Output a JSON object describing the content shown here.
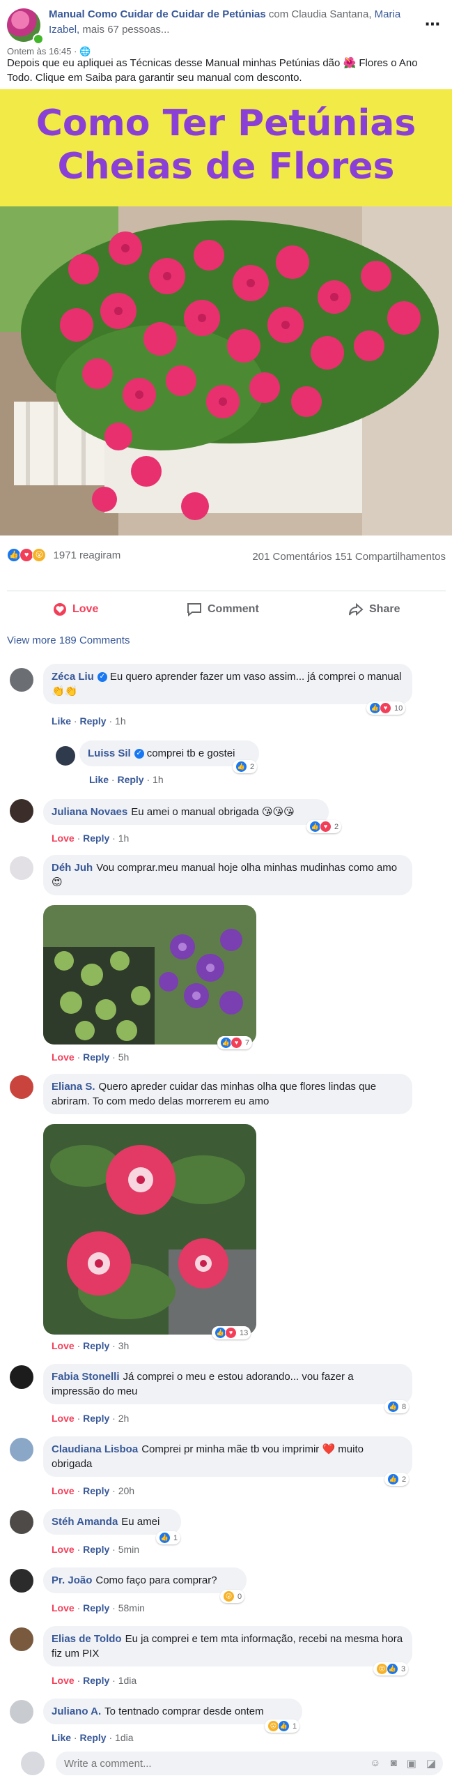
{
  "post": {
    "page_name": "Manual Como Cuidar de Cuidar de Petúnias",
    "with_text": "com Claudia Santana,",
    "with_people": "Maria Izabel,",
    "more_people": "mais 67 pessoas...",
    "time": "Ontem às 16:45 · 🌐",
    "text": "Depois que eu apliquei as Técnicas desse Manual minhas Petúnias dão 🌺 Flores o Ano Todo. Clique em Saiba para garantir seu manual com desconto.",
    "more_icon": "⋯"
  },
  "hero": {
    "line1": "Como Ter Petúnias",
    "line2": "Cheias de Flores"
  },
  "stats": {
    "reactions": "1971 reagiram",
    "comments_shares": "201 Comentários 151 Compartilhamentos"
  },
  "actions": {
    "love": "Love",
    "comment": "Comment",
    "share": "Share"
  },
  "view_more": "View more 189 Comments",
  "comments": [
    {
      "name": "Zéca Liu",
      "text": "Eu quero aprender fazer um vaso assim... já comprei o manual👏👏",
      "like": "Like",
      "reply": "Reply",
      "time": "1h",
      "count": "10"
    },
    {
      "name": "Luiss Sil",
      "text": "comprei tb e gostei",
      "like": "Like",
      "reply": "Reply",
      "time": "1h",
      "count": "2"
    },
    {
      "name": "Juliana Novaes",
      "text": "Eu amei o manual obrigada 😘😘😘",
      "like": "Love",
      "reply": "Reply",
      "time": "1h",
      "count": "2"
    },
    {
      "name": "Déh Juh",
      "text": "Vou comprar.meu manual hoje olha minhas mudinhas como amo😍",
      "like": "Love",
      "reply": "Reply",
      "time": "5h",
      "count": "7"
    },
    {
      "name": "Eliana S.",
      "text": "Quero apreder cuidar das minhas olha que flores lindas que abriram. To com medo delas morrerem eu amo",
      "like": "Love",
      "reply": "Reply",
      "time": "3h",
      "count": "13"
    },
    {
      "name": "Fabia Stonelli",
      "text": "Já comprei o meu e estou adorando... vou fazer a impressão do meu",
      "like": "Love",
      "reply": "Reply",
      "time": "2h",
      "count": "8"
    },
    {
      "name": "Claudiana Lisboa",
      "text": "Comprei pr minha mãe tb vou imprimir ❤️ muito obrigada",
      "like": "Love",
      "reply": "Reply",
      "time": "20h",
      "count": "2"
    },
    {
      "name": "Stéh Amanda",
      "text": "Eu amei",
      "like": "Love",
      "reply": "Reply",
      "time": "5min",
      "count": "1"
    },
    {
      "name": "Pr. João",
      "text": "Como faço para comprar?",
      "like": "Love",
      "reply": "Reply",
      "time": "58min",
      "count": "0"
    },
    {
      "name": "Elias de Toldo",
      "text": "Eu ja comprei e tem mta informação, recebi na mesma hora fiz um PIX",
      "like": "Love",
      "reply": "Reply",
      "time": "1dia",
      "count": "3"
    },
    {
      "name": "Juliano A.",
      "text": "To tentnado comprar desde ontem",
      "like": "Like",
      "reply": "Reply",
      "time": "1dia",
      "count": "1"
    }
  ],
  "composer": {
    "placeholder": "Write a comment..."
  },
  "colors": {
    "link": "#385898",
    "love": "#f33e58",
    "like": "#1877f2",
    "banner_bg": "#f2ea47",
    "banner_text": "#8a3fd6"
  }
}
